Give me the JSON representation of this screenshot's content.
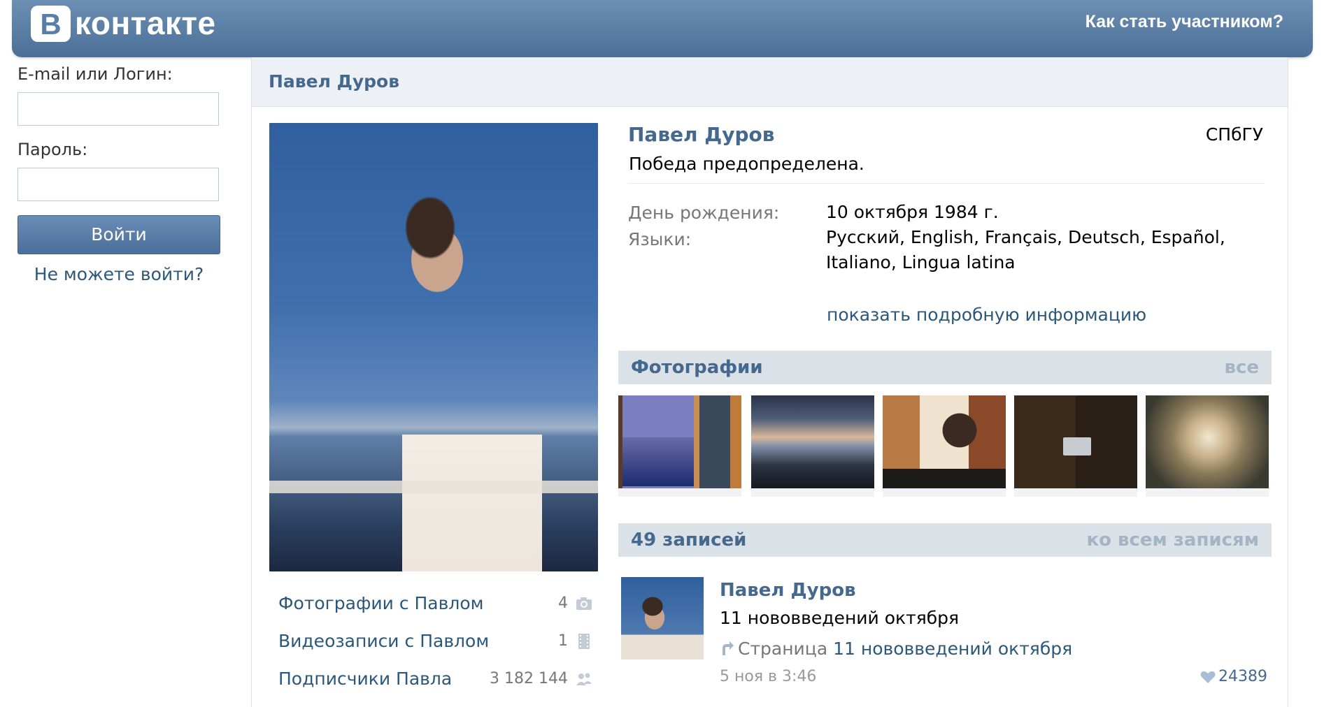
{
  "header": {
    "logo_letter": "В",
    "logo_text": "контакте",
    "join_link": "Как стать участником?"
  },
  "login": {
    "email_label": "E-mail или Логин:",
    "email_value": "",
    "password_label": "Пароль:",
    "password_value": "",
    "submit_label": "Войти",
    "forgot_link": "Не можете войти?"
  },
  "page": {
    "title": "Павел Дуров"
  },
  "profile": {
    "name": "Павел Дуров",
    "university": "СПбГУ",
    "status": "Победа предопределена.",
    "birthday_label": "День рождения:",
    "birthday_value": "10 октября 1984 г.",
    "languages_label": "Языки:",
    "languages_value": "Русский, English, Français, Deutsch, Español, Italiano, Lingua latina",
    "more_info_link": "показать подробную информацию"
  },
  "side_links": [
    {
      "label": "Фотографии с Павлом",
      "count": "4",
      "icon": "camera-icon"
    },
    {
      "label": "Видеозаписи с Павлом",
      "count": "1",
      "icon": "film-icon"
    },
    {
      "label": "Подписчики Павла",
      "count": "3 182 144",
      "icon": "people-icon"
    }
  ],
  "photos": {
    "title": "Фотографии",
    "all_link": "все"
  },
  "posts": {
    "title": "49 записей",
    "all_link": "ко всем записям",
    "items": [
      {
        "author": "Павел Дуров",
        "text": "11 нововведений октября",
        "repost_prefix": "Страница",
        "repost_link": "11 нововведений октября",
        "date": "5 ноя в 3:46",
        "likes": "24389"
      }
    ]
  },
  "colors": {
    "header_bg": "#5a7ea6",
    "link": "#2b587a",
    "title_blue": "#45688e",
    "block_head_bg": "#dae2e8"
  }
}
